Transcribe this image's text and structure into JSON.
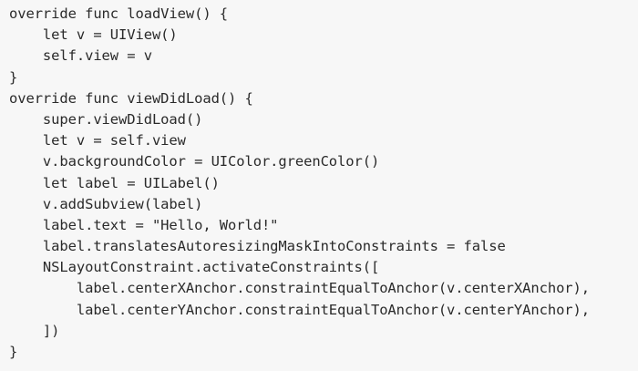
{
  "code": {
    "lines": [
      "override func loadView() {",
      "    let v = UIView()",
      "    self.view = v",
      "}",
      "override func viewDidLoad() {",
      "    super.viewDidLoad()",
      "    let v = self.view",
      "    v.backgroundColor = UIColor.greenColor()",
      "    let label = UILabel()",
      "    v.addSubview(label)",
      "    label.text = \"Hello, World!\"",
      "    label.translatesAutoresizingMaskIntoConstraints = false",
      "    NSLayoutConstraint.activateConstraints([",
      "        label.centerXAnchor.constraintEqualToAnchor(v.centerXAnchor),",
      "        label.centerYAnchor.constraintEqualToAnchor(v.centerYAnchor),",
      "    ])",
      "}"
    ]
  },
  "colors": {
    "background": "#f7f7f7",
    "text": "#2a2a2a"
  }
}
